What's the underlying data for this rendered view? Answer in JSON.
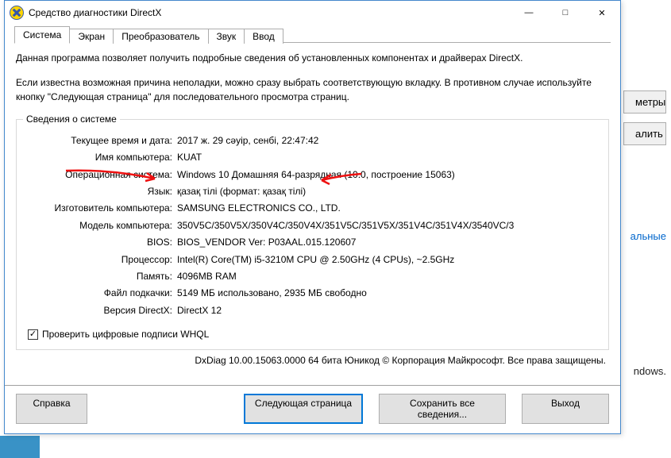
{
  "background": {
    "btn_params": "метры",
    "btn_delete": "алить",
    "link_text": "альные",
    "word_windows": "ndows."
  },
  "window": {
    "title": "Средство диагностики DirectX"
  },
  "tabs": [
    {
      "label": "Система"
    },
    {
      "label": "Экран"
    },
    {
      "label": "Преобразователь"
    },
    {
      "label": "Звук"
    },
    {
      "label": "Ввод"
    }
  ],
  "desc1": "Данная программа позволяет получить подробные сведения об установленных компонентах и драйверах DirectX.",
  "desc2": "Если известна возможная причина неполадки, можно сразу выбрать соответствующую вкладку. В противном случае используйте кнопку \"Следующая страница\" для последовательного просмотра страниц.",
  "group_title": "Сведения о системе",
  "rows": {
    "datetime": {
      "k": "Текущее время и дата:",
      "v": "2017 ж. 29 сәуір, сенбі, 22:47:42"
    },
    "hostname": {
      "k": "Имя компьютера:",
      "v": "KUAT"
    },
    "os": {
      "k": "Операционная система:",
      "v": "Windows 10 Домашняя 64-разрядная (10.0, построение 15063)"
    },
    "lang": {
      "k": "Язык:",
      "v": "қазақ тілі (формат: қазақ тілі)"
    },
    "maker": {
      "k": "Изготовитель компьютера:",
      "v": "SAMSUNG ELECTRONICS CO., LTD."
    },
    "model": {
      "k": "Модель компьютера:",
      "v": "350V5C/350V5X/350V4C/350V4X/351V5C/351V5X/351V4C/351V4X/3540VC/3"
    },
    "bios": {
      "k": "BIOS:",
      "v": "BIOS_VENDOR Ver: P03AAL.015.120607"
    },
    "cpu": {
      "k": "Процессор:",
      "v": "Intel(R) Core(TM) i5-3210M CPU @ 2.50GHz (4 CPUs), ~2.5GHz"
    },
    "mem": {
      "k": "Память:",
      "v": "4096MB RAM"
    },
    "swap": {
      "k": "Файл подкачки:",
      "v": "5149 МБ использовано, 2935 МБ свободно"
    },
    "dxver": {
      "k": "Версия DirectX:",
      "v": "DirectX 12"
    }
  },
  "whql_label": "Проверить цифровые подписи WHQL",
  "footer": "DxDiag 10.00.15063.0000 64 бита Юникод © Корпорация Майкрософт. Все права защищены.",
  "buttons": {
    "help": "Справка",
    "next": "Следующая страница",
    "save": "Сохранить все сведения...",
    "exit": "Выход"
  }
}
